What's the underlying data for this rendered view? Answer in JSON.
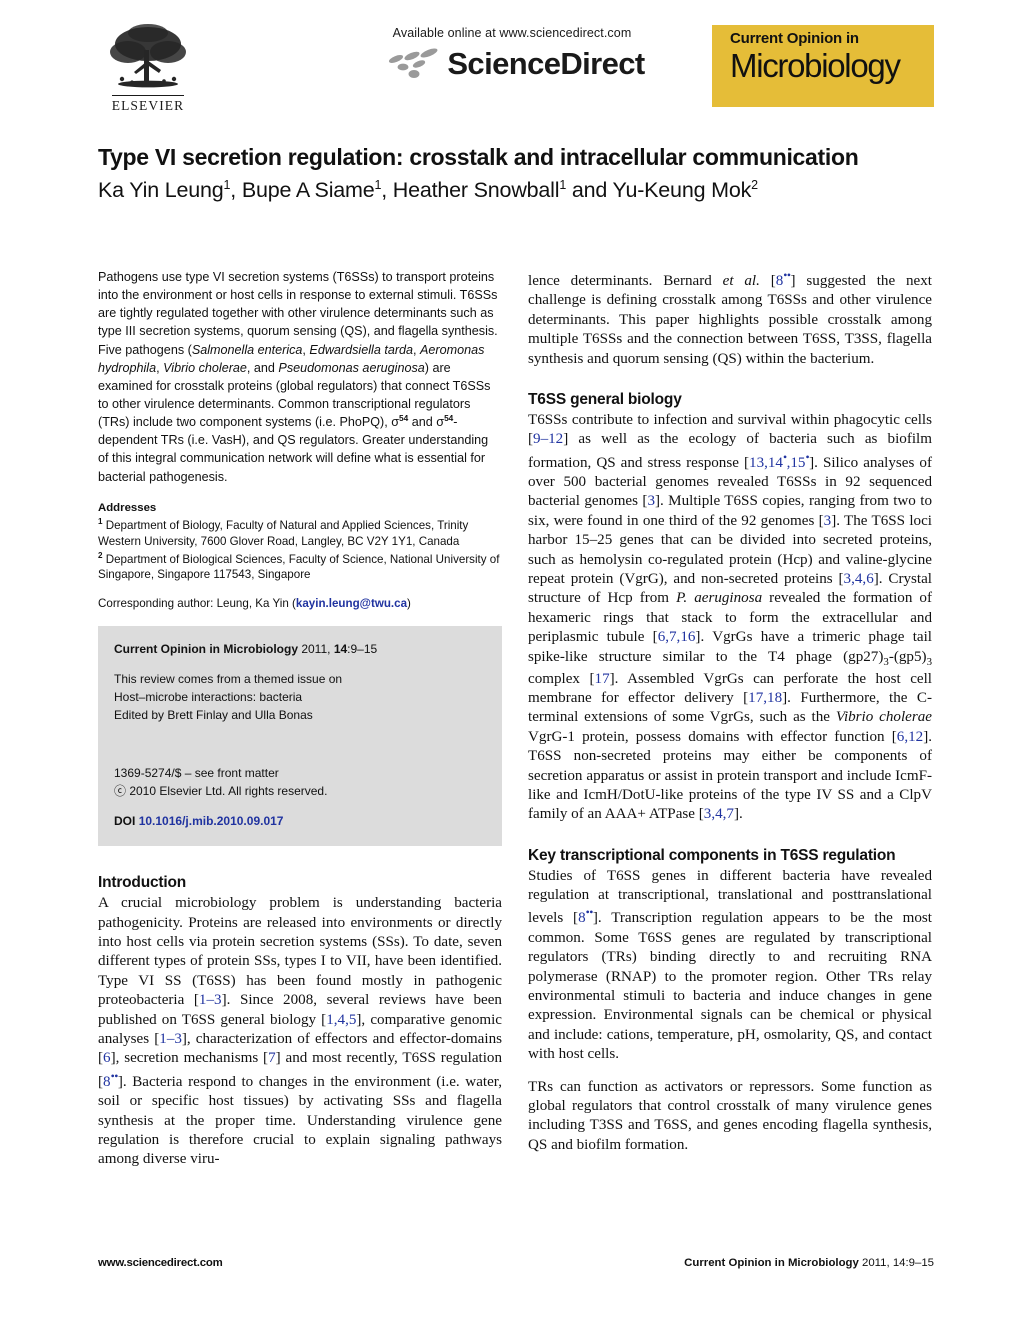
{
  "masthead": {
    "publisher": "ELSEVIER",
    "available_line": "Available online at www.sciencedirect.com",
    "sciencedirect_word": "ScienceDirect",
    "journal_logo_top": "Current Opinion in",
    "journal_logo_bottom": "Microbiology",
    "journal_logo_color": "#e5bd38"
  },
  "article": {
    "title": "Type VI secretion regulation: crosstalk and intracellular communication",
    "authors_html": "Ka Yin Leung<sup class=\"aff\">1</sup>, Bupe A Siame<sup class=\"aff\">1</sup>, Heather Snowball<sup class=\"aff\">1</sup> and Yu-Keung Mok<sup class=\"aff\">2</sup>"
  },
  "abstract": {
    "html": "Pathogens use type VI secretion systems (T6SSs) to transport proteins into the environment or host cells in response to external stimuli. T6SSs are tightly regulated together with other virulence determinants such as type III secretion systems, quorum sensing (QS), and flagella synthesis. Five pathogens (<i>Salmonella enterica</i>, <i>Edwardsiella tarda</i>, <i>Aeromonas hydrophila</i>, <i>Vibrio cholerae</i>, and <i>Pseudomonas aeruginosa</i>) are examined for crosstalk proteins (global regulators) that connect T6SSs to other virulence determinants. Common transcriptional regulators (TRs) include two component systems (i.e. PhoPQ), &#963;<sup>54</sup> and &#963;<sup>54</sup>-dependent TRs (i.e. VasH), and QS regulators. Greater understanding of this integral communication network will define what is essential for bacterial pathogenesis."
  },
  "addresses": {
    "heading": "Addresses",
    "html": "<sup>1</sup> Department of Biology, Faculty of Natural and Applied Sciences, Trinity Western University, 7600 Glover Road, Langley, BC V2Y 1Y1, Canada<br><sup>2</sup> Department of Biological Sciences, Faculty of Science, National University of Singapore, Singapore 117543, Singapore",
    "corresponding_label": "Corresponding author: Leung, Ka Yin (",
    "corresponding_email": "kayin.leung@twu.ca",
    "corresponding_close": ")"
  },
  "infobox": {
    "citation_journal": "Current Opinion in Microbiology",
    "citation_rest_html": " 2011, <b>14</b>:9–15",
    "themed_line1": "This review comes from a themed issue on",
    "themed_line2": "Host–microbe interactions: bacteria",
    "themed_line3": "Edited by Brett Finlay and Ulla Bonas",
    "front_matter": "1369-5274/$ – see front matter",
    "copyright": "ⓒ 2010 Elsevier Ltd. All rights reserved.",
    "doi_label": "DOI",
    "doi_value": "10.1016/j.mib.2010.09.017"
  },
  "sections": {
    "introduction_heading": "Introduction",
    "t6ss_general_heading": "T6SS general biology",
    "key_transcriptional_heading": "Key transcriptional components in T6SS regulation"
  },
  "body": {
    "intro_p1_html": "A crucial microbiology problem is understanding bacteria pathogenicity. Proteins are released into environments or directly into host cells via protein secretion systems (SSs). To date, seven different types of protein SSs, types I to VII, have been identified. Type VI SS (T6SS) has been found mostly in pathogenic proteobacteria [<span class=\"ref\">1–3</span>]. Since 2008, several reviews have been published on T6SS general biology [<span class=\"ref\">1,4,5</span>], comparative genomic analyses [<span class=\"ref\">1–3</span>], characterization of effectors and effector-domains [<span class=\"ref\">6</span>], secretion mechanisms [<span class=\"ref\">7</span>] and most recently, T6SS regulation [<span class=\"ref\">8<span class=\"star\">••</span></span>]. Bacteria respond to changes in the environment (i.e. water, soil or specific host tissues) by activating SSs and flagella synthesis at the proper time. Understanding virulence gene regulation is therefore crucial to explain signaling pathways among diverse viru-",
    "right_p1_html": "lence determinants. Bernard <i>et al.</i> [<span class=\"ref\">8<span class=\"star\">••</span></span>] suggested the next challenge is defining crosstalk among T6SSs and other virulence determinants. This paper highlights possible crosstalk among multiple T6SSs and the connection between T6SS, T3SS, flagella synthesis and quorum sensing (QS) within the bacterium.",
    "t6ss_general_p1_html": "T6SSs contribute to infection and survival within phagocytic cells [<span class=\"ref\">9–12</span>] as well as the ecology of bacteria such as biofilm formation, QS and stress response [<span class=\"ref\">13,14<span class=\"star\">•</span>,15<span class=\"star\">•</span></span>]. Silico analyses of over 500 bacterial genomes revealed T6SSs in 92 sequenced bacterial genomes [<span class=\"ref\">3</span>]. Multiple T6SS copies, ranging from two to six, were found in one third of the 92 genomes [<span class=\"ref\">3</span>]. The T6SS loci harbor 15–25 genes that can be divided into secreted proteins, such as hemolysin co-regulated protein (Hcp) and valine-glycine repeat protein (VgrG), and non-secreted proteins [<span class=\"ref\">3,4,6</span>]. Crystal structure of Hcp from <i>P. aeruginosa</i> revealed the formation of hexameric rings that stack to form the extracellular and periplasmic tubule [<span class=\"ref\">6,7,16</span>]. VgrGs have a trimeric phage tail spike-like structure similar to the T4 phage (gp27)<sub>3</sub>-(gp5)<sub>3</sub> complex [<span class=\"ref\">17</span>]. Assembled VgrGs can perforate the host cell membrane for effector delivery [<span class=\"ref\">17,18</span>]. Furthermore, the C-terminal extensions of some VgrGs, such as the <i>Vibrio cholerae</i> VgrG-1 protein, possess domains with effector function [<span class=\"ref\">6,12</span>]. T6SS non-secreted proteins may either be components of secretion apparatus or assist in protein transport and include IcmF-like and IcmH/DotU-like proteins of the type IV SS and a ClpV family of an AAA+ ATPase [<span class=\"ref\">3,4,7</span>].",
    "key_trans_p1_html": "Studies of T6SS genes in different bacteria have revealed regulation at transcriptional, translational and posttranslational levels [<span class=\"ref\">8<span class=\"star\">••</span></span>]. Transcription regulation appears to be the most common. Some T6SS genes are regulated by transcriptional regulators (TRs) binding directly to and recruiting RNA polymerase (RNAP) to the promoter region. Other TRs relay environmental stimuli to bacteria and induce changes in gene expression. Environmental signals can be chemical or physical and include: cations, temperature, pH, osmolarity, QS, and contact with host cells.",
    "key_trans_p2_html": "TRs can function as activators or repressors. Some function as global regulators that control crosstalk of many virulence genes including T3SS and T6SS, and genes encoding flagella synthesis, QS and biofilm formation."
  },
  "footer": {
    "left": "www.sciencedirect.com",
    "right_journal": "Current Opinion in Microbiology",
    "right_rest": " 2011, 14:9–15"
  }
}
